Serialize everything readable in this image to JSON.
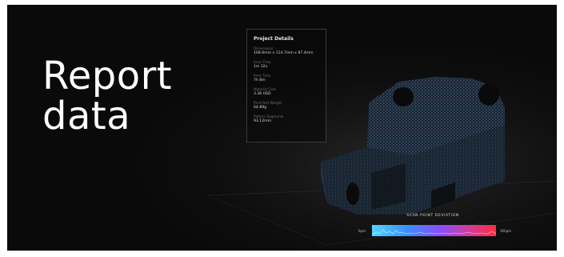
{
  "hero": {
    "line1": "Report",
    "line2": "data"
  },
  "details_panel": {
    "title": "Project Details",
    "fields": [
      {
        "label": "Dimensions",
        "value": "108.6mm x 114.7mm x 87.4mm"
      },
      {
        "label": "Scan Time",
        "value": "1m 32s"
      },
      {
        "label": "Print Time",
        "value": "7h 8m"
      },
      {
        "label": "Material Cost",
        "value": "3.36 USD"
      },
      {
        "label": "Print Part Weight",
        "value": "64.89g"
      },
      {
        "label": "Pattern Segments",
        "value": "93.12mm"
      }
    ]
  },
  "deviation": {
    "title": "SCAN POINT DEVIATION",
    "min": "0µm",
    "max": "300µm"
  },
  "colors": {
    "background": "#0a0a0a",
    "text": "#ffffff",
    "point_cloud": "#3aa0c8",
    "deviation_low": "#4fd6ff",
    "deviation_high": "#ff2d3f"
  }
}
